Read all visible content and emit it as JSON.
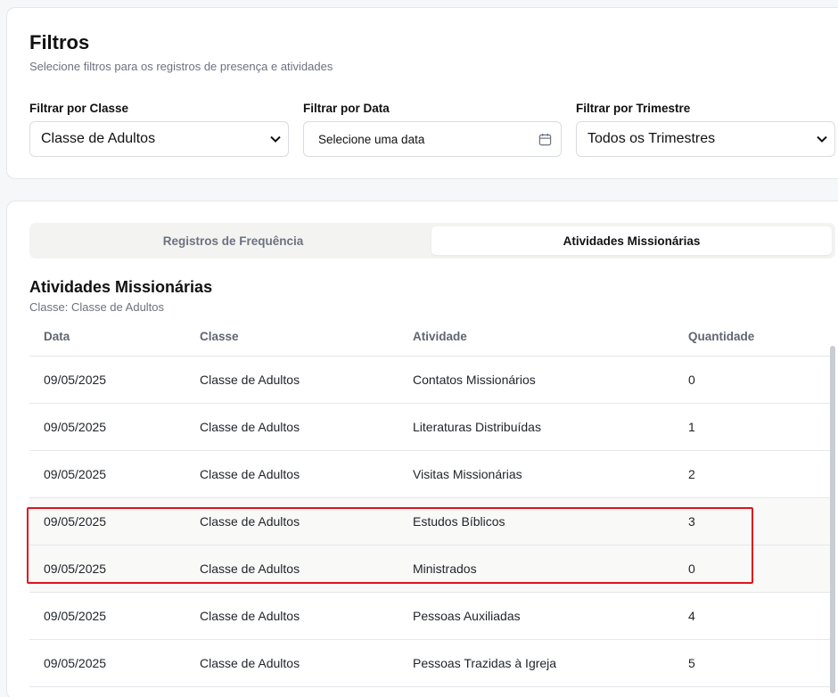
{
  "filters": {
    "title": "Filtros",
    "subtitle": "Selecione filtros para os registros de presença e atividades",
    "class_filter": {
      "label": "Filtrar por Classe",
      "value": "Classe de Adultos"
    },
    "date_filter": {
      "label": "Filtrar por Data",
      "placeholder": "Selecione uma data"
    },
    "quarter_filter": {
      "label": "Filtrar por Trimestre",
      "value": "Todos os Trimestres"
    }
  },
  "tabs": [
    {
      "label": "Registros de Frequência",
      "active": false
    },
    {
      "label": "Atividades Missionárias",
      "active": true
    }
  ],
  "section": {
    "title": "Atividades Missionárias",
    "subtitle": "Classe: Classe de Adultos"
  },
  "table": {
    "headers": [
      "Data",
      "Classe",
      "Atividade",
      "Quantidade"
    ],
    "rows": [
      [
        "09/05/2025",
        "Classe de Adultos",
        "Contatos Missionários",
        "0"
      ],
      [
        "09/05/2025",
        "Classe de Adultos",
        "Literaturas Distribuídas",
        "1"
      ],
      [
        "09/05/2025",
        "Classe de Adultos",
        "Visitas Missionárias",
        "2"
      ],
      [
        "09/05/2025",
        "Classe de Adultos",
        "Estudos Bíblicos",
        "3"
      ],
      [
        "09/05/2025",
        "Classe de Adultos",
        "Ministrados",
        "0"
      ],
      [
        "09/05/2025",
        "Classe de Adultos",
        "Pessoas Auxiliadas",
        "4"
      ],
      [
        "09/05/2025",
        "Classe de Adultos",
        "Pessoas Trazidas à Igreja",
        "5"
      ]
    ]
  },
  "colors": {
    "highlight_border": "#e0131b",
    "muted_text": "#6b7280"
  },
  "icons": {
    "select_arrow": "chevron-down-icon",
    "date_picker": "calendar-icon"
  }
}
